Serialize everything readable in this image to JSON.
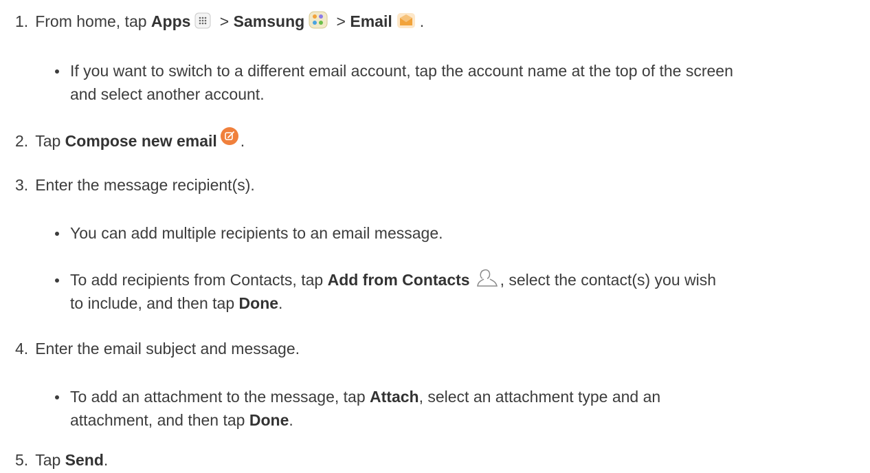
{
  "steps": [
    {
      "number": "1.",
      "text_a": "From home, tap ",
      "bold_a": "Apps",
      "sep_a": " > ",
      "bold_b": "Samsung",
      "sep_b": " > ",
      "bold_c": "Email",
      "end": ".",
      "icons": [
        "apps-grid-icon",
        "samsung-folder-icon",
        "email-app-icon"
      ],
      "bullets": [
        {
          "text": "If you want to switch to a different email account, tap the account name at the top of the screen and select another account."
        }
      ]
    },
    {
      "number": "2.",
      "text_a": "Tap ",
      "bold_a": "Compose new email",
      "end": ".",
      "icons": [
        "compose-email-icon"
      ]
    },
    {
      "number": "3.",
      "text_a": "Enter the message recipient(s).",
      "bullets": [
        {
          "text": "You can add multiple recipients to an email message."
        },
        {
          "text_a": "To add recipients from Contacts, tap ",
          "bold_a": "Add from Contacts",
          "text_b": ", select the contact(s) you wish",
          "text_c": "to include, and then tap ",
          "bold_b": "Done",
          "end": ".",
          "icons": [
            "add-contact-icon"
          ]
        }
      ]
    },
    {
      "number": "4.",
      "text_a": "Enter the email subject and message.",
      "bullets": [
        {
          "text_a": "To add an attachment to the message, tap ",
          "bold_a": "Attach",
          "text_b": ", select an attachment type and an",
          "text_c": "attachment, and then tap ",
          "bold_b": "Done",
          "end": "."
        }
      ]
    },
    {
      "number": "5.",
      "text_a": "Tap ",
      "bold_a": "Send",
      "end": "."
    }
  ],
  "colors": {
    "text": "#3c3c3c",
    "compose_icon": "#f0803c",
    "email_icon": "#f2a33a",
    "contact_icon": "#8a8a8a"
  }
}
